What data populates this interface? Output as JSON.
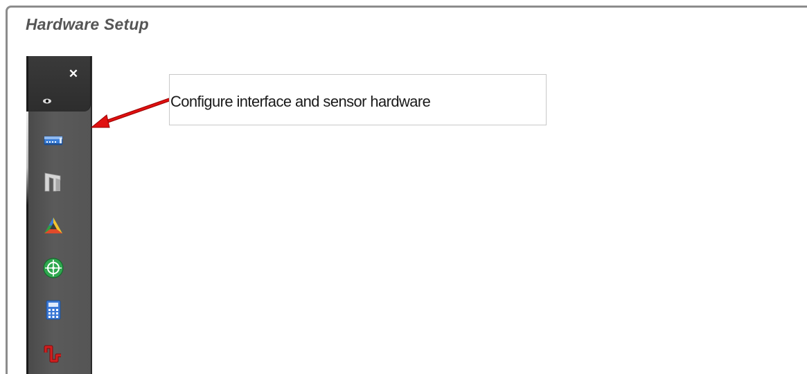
{
  "page": {
    "title": "Hardware Setup"
  },
  "toolbar": {
    "close_glyph": "✕",
    "items": [
      {
        "icon": "interface-hardware-icon",
        "color": "#3a7ed8"
      },
      {
        "icon": "gantry-icon",
        "color": "#d0d0d0"
      },
      {
        "icon": "colored-triangle-icon",
        "color": "#2f9e44"
      },
      {
        "icon": "green-target-icon",
        "color": "#2fa84f"
      },
      {
        "icon": "calculator-icon",
        "color": "#3b78d6"
      },
      {
        "icon": "red-waveform-icon",
        "color": "#d11f1f"
      }
    ]
  },
  "callout": {
    "text": "Configure interface and sensor hardware",
    "arrow_color": "#e01010"
  }
}
